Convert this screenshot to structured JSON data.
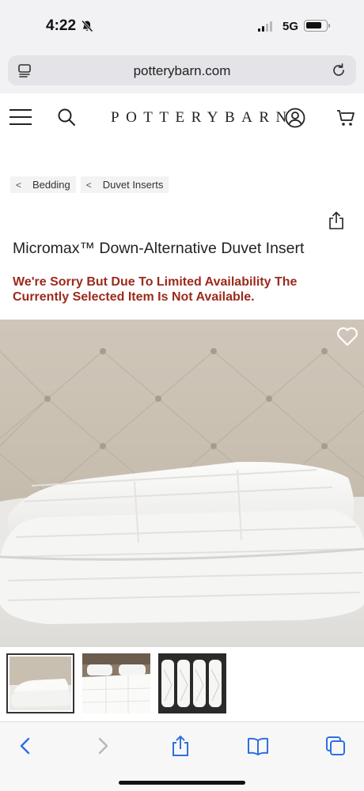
{
  "status_bar": {
    "time": "4:22",
    "network": "5G"
  },
  "browser": {
    "url": "potterybarn.com"
  },
  "site": {
    "logo": "POTTERYBARN"
  },
  "breadcrumb": [
    {
      "chevron": "<",
      "label": "Bedding"
    },
    {
      "chevron": "<",
      "label": "Duvet Inserts"
    }
  ],
  "product": {
    "title": "Micromax™ Down-Alternative Duvet Insert",
    "availability_message": "We're Sorry But Due To Limited Availability The Currently Selected Item Is Not Available."
  },
  "icons": {
    "status": [
      "bell-off-icon",
      "signal-icon",
      "battery-icon"
    ],
    "browser": [
      "tab-icon",
      "reload-icon"
    ],
    "header": [
      "menu-icon",
      "search-icon",
      "account-icon",
      "cart-icon"
    ],
    "page": [
      "share-icon",
      "favorite-heart-icon"
    ],
    "toolbar": [
      "back-icon",
      "forward-icon",
      "share-icon",
      "bookmarks-icon",
      "tabs-icon"
    ]
  },
  "colors": {
    "alert": "#9b2a1c",
    "chrome": "#f2f2f4",
    "url_bar": "#e3e3e8"
  }
}
